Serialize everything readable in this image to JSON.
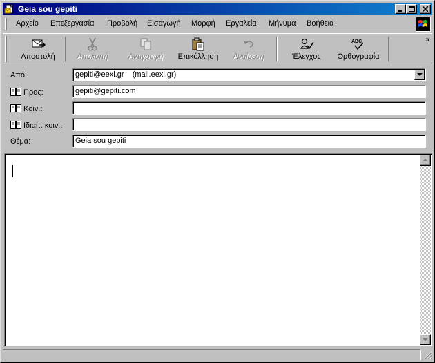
{
  "window": {
    "title": "Geia sou gepiti",
    "minimize_icon": "minimize-icon",
    "maximize_icon": "maximize-icon",
    "close_icon": "close-icon",
    "accent": "#000080"
  },
  "menubar": {
    "items": [
      {
        "label": "Αρχείο"
      },
      {
        "label": "Επεξεργασία"
      },
      {
        "label": "Προβολή"
      },
      {
        "label": "Εισαγωγή"
      },
      {
        "label": "Μορφή"
      },
      {
        "label": "Εργαλεία"
      },
      {
        "label": "Μήνυμα"
      },
      {
        "label": "Βοήθεια"
      }
    ]
  },
  "toolbar": {
    "send": "Αποστολή",
    "cut": "Αποκοπή",
    "copy": "Αντιγραφή",
    "paste": "Επικόλληση",
    "undo": "Αναίρεση",
    "check": "Έλεγχος",
    "spelling": "Ορθογραφία",
    "more": "»"
  },
  "header": {
    "from_label": "Από:",
    "from_value": "gepiti@eexi.gr    (mail.eexi.gr)",
    "to_label": "Προς:",
    "to_value": "gepiti@gepiti.com",
    "cc_label": "Κοιν.:",
    "cc_value": "",
    "bcc_label": "Ιδιαίτ. κοιν.:",
    "bcc_value": "",
    "subject_label": "Θέμα:",
    "subject_value": "Geia sou gepiti"
  },
  "body": {
    "text": ""
  }
}
